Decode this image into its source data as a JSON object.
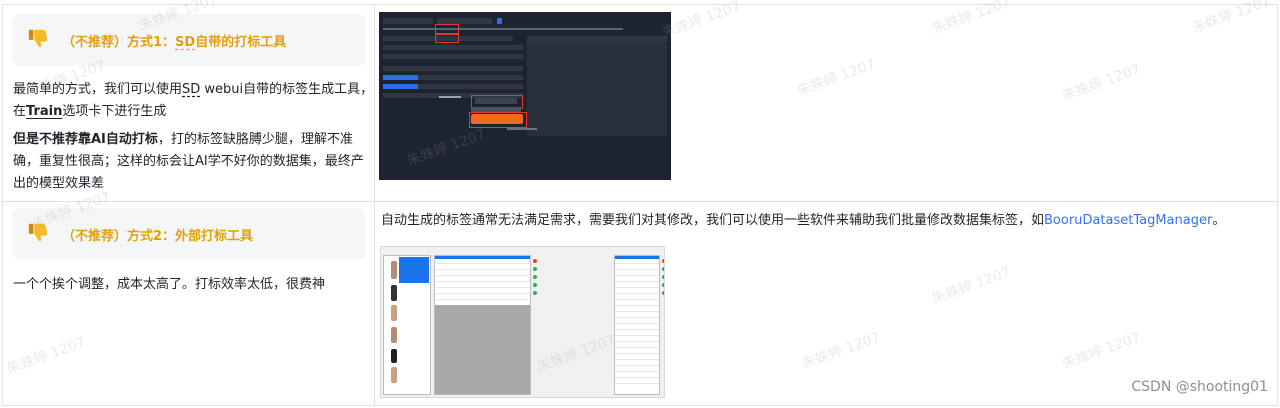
{
  "rows": [
    {
      "callout": {
        "icon": "thumbs-down-icon",
        "prefix": "（不推荐）方式1：",
        "sd": "SD",
        "suffix": "自带的打标工具"
      },
      "para1": {
        "l1a": "最简单的方式，我们可以使用",
        "l1sd": "SD",
        "l1b": " webui自带的标签生成工具，",
        "l2a": "在",
        "l2b": "Train",
        "l2c": "选项卡下进行生成"
      },
      "para2": {
        "l1b": "但是不推荐靠AI自动打标",
        "l1c": "，打的标签缺胳膊少腿，理解不准",
        "l2": "确，重复性很高；这样的标会让AI学不好你的数据集，最终产",
        "l3": "出的模型效果差"
      }
    },
    {
      "callout": {
        "icon": "thumbs-down-icon",
        "text": "（不推荐）方式2：外部打标工具"
      },
      "para": "一个个挨个调整，成本太高了。打标效率太低，很费神",
      "right": {
        "text": "自动生成的标签通常无法满足需求，需要我们对其修改，我们可以使用一些软件来辅助我们批量修改数据集标签，如",
        "link": "BooruDatasetTagManager",
        "end": "。"
      }
    }
  ],
  "watermark": "朱姝婷 1207",
  "footer": "CSDN @shooting01",
  "colors": {
    "callout_text": "#e3a008",
    "link": "#3370ff",
    "button": "#f26b1d",
    "highlight": "#e23b2e"
  }
}
